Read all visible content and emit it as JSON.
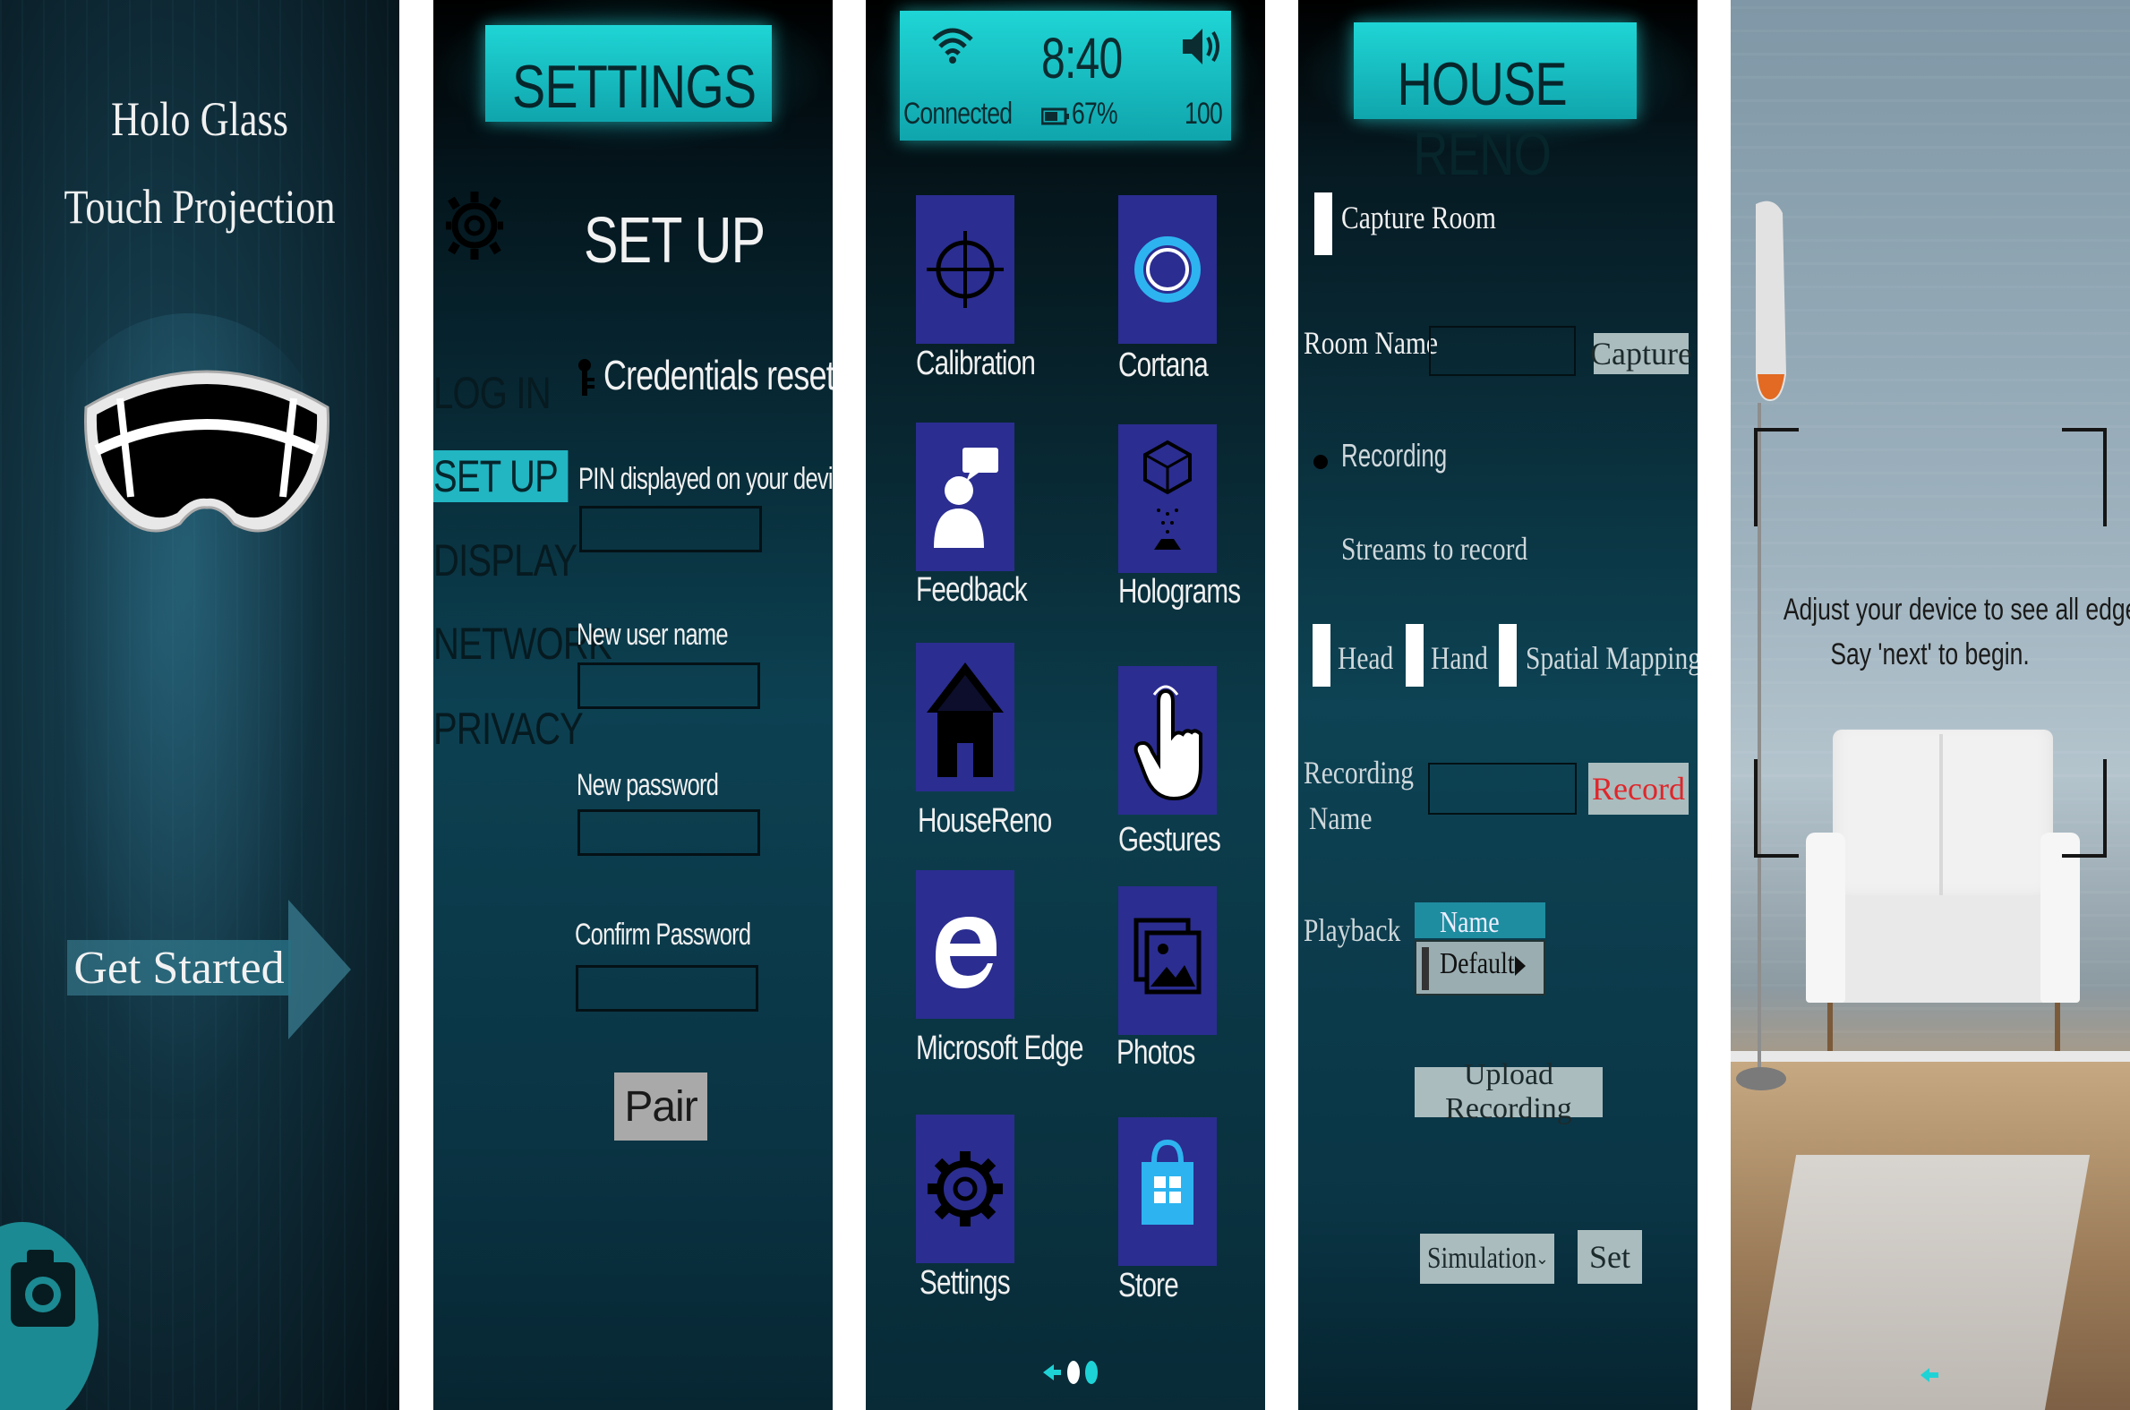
{
  "panel1": {
    "title_line1": "Holo Glass",
    "title_line2": "Touch Projection",
    "get_started_label": "Get Started"
  },
  "panel2": {
    "header": "SETTINGS",
    "section_title": "SET UP",
    "nav": [
      "LOG IN",
      "SET UP",
      "DISPLAY",
      "NETWORK",
      "PRIVACY"
    ],
    "credentials_reset": "Credentials reset",
    "fields": {
      "pin_label": "PIN displayed on your device",
      "new_user_label": "New user name",
      "new_password_label": "New password",
      "confirm_password_label": "Confirm Password"
    },
    "pair_label": "Pair"
  },
  "panel3": {
    "status": {
      "time": "8:40",
      "wifi_text": "Connected",
      "battery": "67%",
      "volume": "100"
    },
    "apps": [
      {
        "label": "Calibration"
      },
      {
        "label": "Cortana"
      },
      {
        "label": "Feedback"
      },
      {
        "label": "Holograms"
      },
      {
        "label": "HouseReno"
      },
      {
        "label": "Gestures"
      },
      {
        "label": "Microsoft Edge"
      },
      {
        "label": "Photos"
      },
      {
        "label": "Settings"
      },
      {
        "label": "Store"
      }
    ]
  },
  "panel4": {
    "header": "HOUSE RENO",
    "capture_room": "Capture Room",
    "room_name_label": "Room Name",
    "capture_button": "Capture",
    "recording_label": "Recording",
    "streams_label": "Streams to record",
    "streams": [
      "Head",
      "Hand",
      "Spatial Mapping"
    ],
    "recording_name_line1": "Recording",
    "recording_name_line2": "Name",
    "record_button": "Record",
    "playback_label": "Playback",
    "name_header": "Name",
    "default_value": "Default",
    "upload_button": "Upload Recording",
    "simulation_select": "Simulation",
    "set_button": "Set",
    "colors": {
      "record_text": "#e0262a",
      "button_bg": "#aabcbe"
    }
  },
  "panel5": {
    "instruction_line1": "Adjust your device to see all edges.",
    "instruction_line2": "Say 'next' to begin."
  }
}
